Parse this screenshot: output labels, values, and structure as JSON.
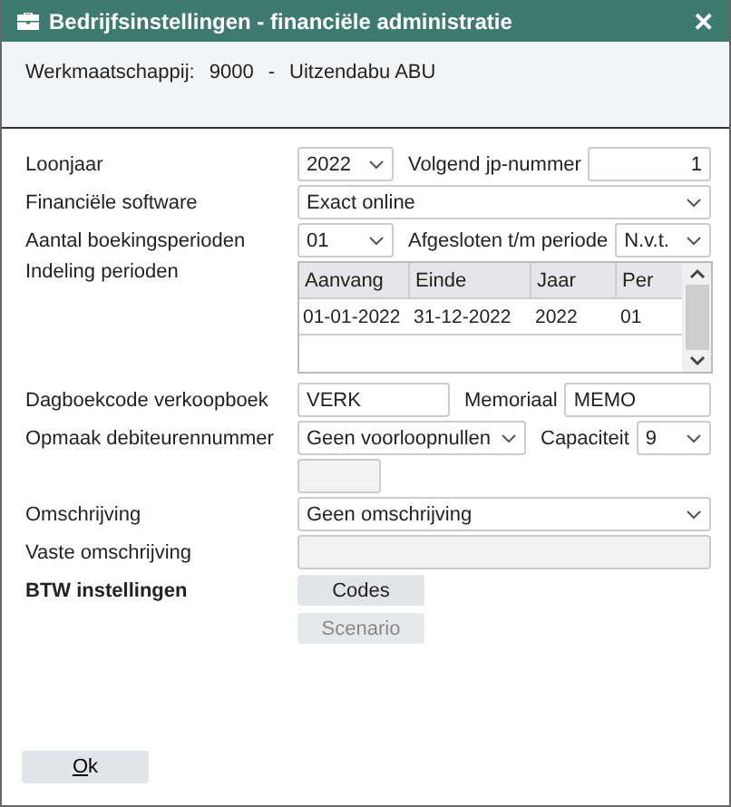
{
  "window": {
    "title": "Bedrijfsinstellingen - financiële administratie",
    "close": "✕"
  },
  "header": {
    "company_label": "Werkmaatschappij:",
    "company_code": "9000",
    "separator": "-",
    "company_name": "Uitzendabu ABU"
  },
  "loonjaar": {
    "label": "Loonjaar",
    "value": "2022"
  },
  "volgend_jp": {
    "label": "Volgend jp-nummer",
    "value": "1"
  },
  "software": {
    "label": "Financiële software",
    "value": "Exact online"
  },
  "perioden": {
    "label": "Aantal boekingsperioden",
    "value": "01"
  },
  "afgesloten": {
    "label": "Afgesloten t/m periode",
    "value": "N.v.t."
  },
  "indeling": {
    "label": "Indeling perioden",
    "table": {
      "columns": [
        "Aanvang",
        "Einde",
        "Jaar",
        "Per"
      ],
      "rows": [
        [
          "01-01-2022",
          "31-12-2022",
          "2022",
          "01"
        ]
      ]
    }
  },
  "dagboek": {
    "label": "Dagboekcode verkoopboek",
    "value": "VERK"
  },
  "memoriaal": {
    "label": "Memoriaal",
    "value": "MEMO"
  },
  "opmaak": {
    "label": "Opmaak debiteurennummer",
    "value": "Geen voorloopnullen"
  },
  "capaciteit": {
    "label": "Capaciteit",
    "value": "9"
  },
  "voorbeeld": {
    "disabled": true
  },
  "omschrijving": {
    "label": "Omschrijving",
    "value": "Geen omschrijving"
  },
  "vaste": {
    "label": "Vaste omschrijving",
    "disabled": true
  },
  "btw": {
    "label": "BTW instellingen",
    "buttons": [
      {
        "label": "Codes",
        "disabled": false
      },
      {
        "label": "Scenario",
        "disabled": true
      }
    ]
  },
  "ok": {
    "label": "Ok",
    "mnemonic": true
  }
}
